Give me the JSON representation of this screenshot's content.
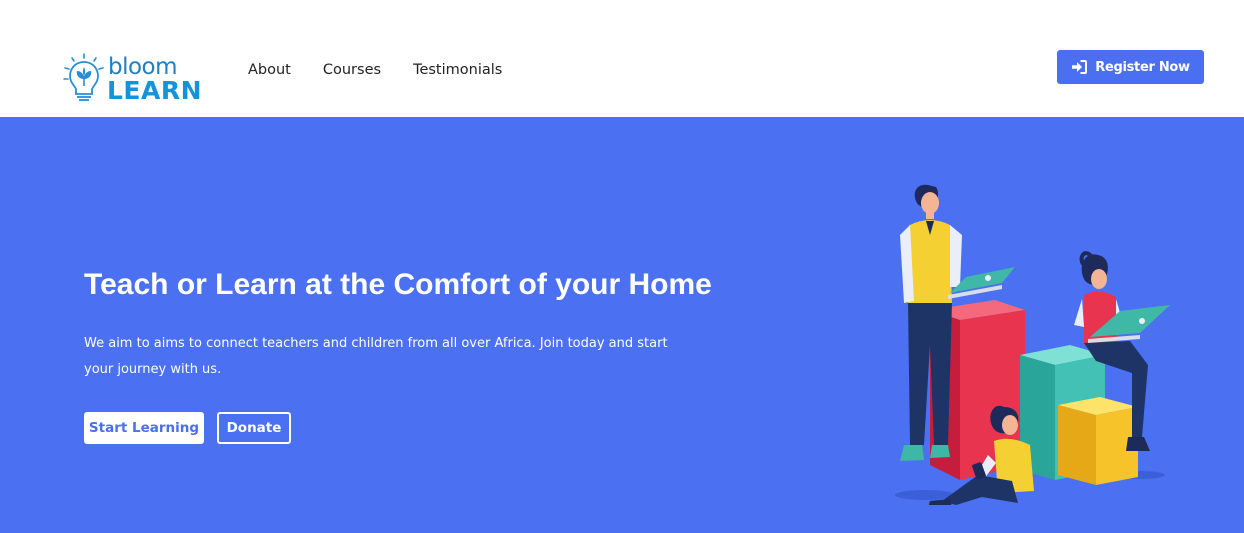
{
  "brand": {
    "word1": "bloom",
    "word2": "LEARN",
    "icon": "lightbulb-logo-icon"
  },
  "nav": {
    "links": [
      "About",
      "Courses",
      "Testimonials"
    ]
  },
  "header": {
    "register_label": "Register Now",
    "register_icon": "sign-in-icon"
  },
  "hero": {
    "title": "Teach or Learn at the Comfort of your Home",
    "description": "We aim to aims to connect teachers and children from all over Africa. Join today and start your journey with us.",
    "start_label": "Start Learning",
    "donate_label": "Donate",
    "illustration": "people-learning-illustration"
  },
  "colors": {
    "accent": "#4b6ff1",
    "hero_bg": "#4b71f2",
    "logo_blue": "#1593d8"
  }
}
